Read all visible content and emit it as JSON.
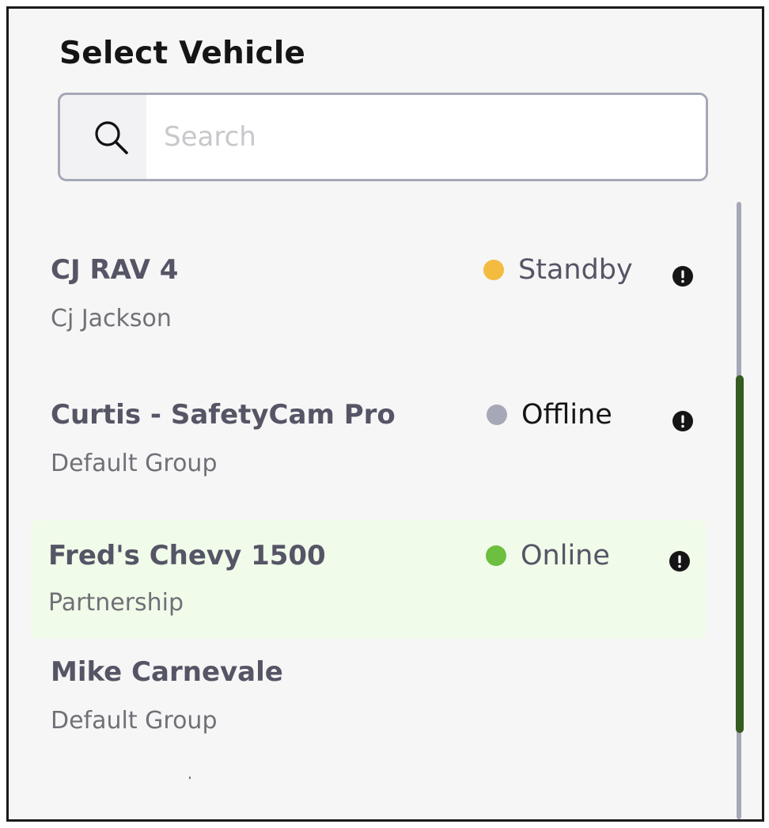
{
  "header": {
    "title": "Select Vehicle"
  },
  "search": {
    "placeholder": "Search",
    "value": "",
    "icon": "search-icon"
  },
  "colors": {
    "standby": "#f3bb3f",
    "offline": "#a6a8b8",
    "online": "#6cbf3f",
    "selected_row_bg": "#f0fbe9",
    "scroll_thumb": "#355b22"
  },
  "vehicles": [
    {
      "name": "CJ RAV 4",
      "subtitle": "Cj Jackson",
      "status": "Standby",
      "status_color": "#f3bb3f",
      "status_text_color": "#555566",
      "alert_icon": "alert-icon",
      "selected": false
    },
    {
      "name": "Curtis - SafetyCam Pro",
      "subtitle": "Default Group",
      "status": "Offline",
      "status_color": "#a6a8b8",
      "status_text_color": "#151515",
      "alert_icon": "alert-icon",
      "selected": false
    },
    {
      "name": "Fred's Chevy 1500",
      "subtitle": "Partnership",
      "status": "Online",
      "status_color": "#6cbf3f",
      "status_text_color": "#555566",
      "alert_icon": "alert-icon",
      "selected": true
    },
    {
      "name": "Mike Carnevale",
      "subtitle": "Default Group",
      "status": "",
      "selected": false
    }
  ]
}
